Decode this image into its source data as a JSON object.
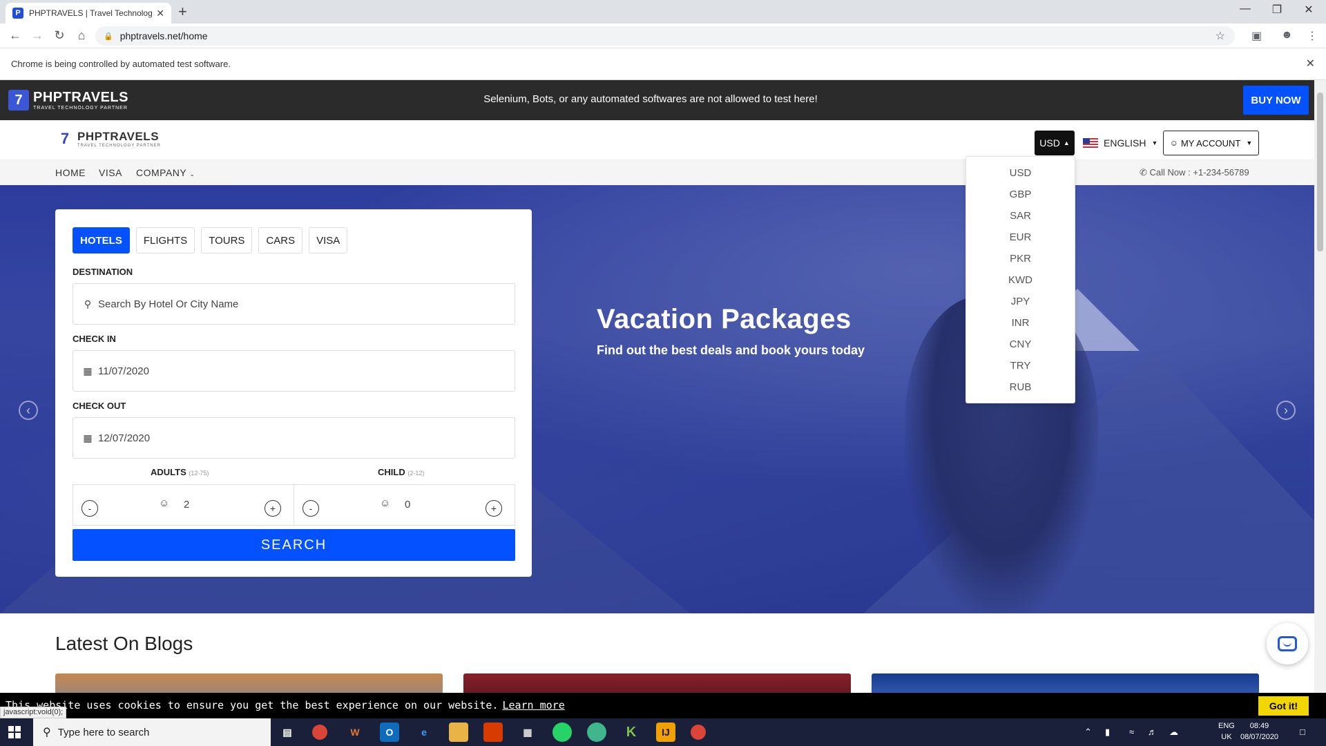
{
  "browser": {
    "tab_title": "PHPTRAVELS | Travel Technology",
    "tab_close": "✕",
    "new_tab": "+",
    "url": "phptravels.net/home",
    "infobar_text": "Chrome is being controlled by automated test software.",
    "infobar_close": "✕"
  },
  "promo": {
    "logo_name": "PHPTRAVELS",
    "logo_tag": "TRAVEL TECHNOLOGY PARTNER",
    "message": "Selenium, Bots, or any automated softwares are not allowed to test here!",
    "buy_now": "BUY NOW"
  },
  "header": {
    "logo_name": "PHPTRAVELS",
    "logo_tag": "TRAVEL TECHNOLOGY PARTNER",
    "currency": "USD",
    "language": "ENGLISH",
    "account": "MY ACCOUNT"
  },
  "nav": {
    "items": [
      "HOME",
      "VISA",
      "COMPANY"
    ],
    "call": "Call Now : +1-234-56789"
  },
  "currency_dropdown": {
    "options": [
      "USD",
      "GBP",
      "SAR",
      "EUR",
      "PKR",
      "KWD",
      "JPY",
      "INR",
      "CNY",
      "TRY",
      "RUB"
    ]
  },
  "search": {
    "tabs": [
      "HOTELS",
      "FLIGHTS",
      "TOURS",
      "CARS",
      "VISA"
    ],
    "active_tab": "HOTELS",
    "destination_label": "DESTINATION",
    "destination_placeholder": "Search By Hotel Or City Name",
    "checkin_label": "CHECK IN",
    "checkin_value": "11/07/2020",
    "checkout_label": "CHECK OUT",
    "checkout_value": "12/07/2020",
    "adults_label": "ADULTS",
    "adults_range": "(12-75)",
    "adults_value": "2",
    "child_label": "CHILD",
    "child_range": "(2-12)",
    "child_value": "0",
    "minus": "-",
    "plus": "+",
    "search_button": "SEARCH"
  },
  "hero": {
    "title": "Vacation Packages",
    "subtitle": "Find out the best deals and book yours today"
  },
  "blogs": {
    "title": "Latest On Blogs"
  },
  "cookie": {
    "text": "This website uses cookies to ensure you get the best experience on our website.",
    "learn_more": "Learn more",
    "got_it": "Got it!",
    "status_tip": "javascript:void(0);"
  },
  "taskbar": {
    "search_placeholder": "Type here to search",
    "lang_line1": "ENG",
    "lang_line2": "UK",
    "time": "08:49",
    "date": "08/07/2020"
  },
  "colors": {
    "brand_blue": "#0451ff",
    "promo_bg": "#2b2b2b",
    "cookie_button": "#f1d600"
  }
}
